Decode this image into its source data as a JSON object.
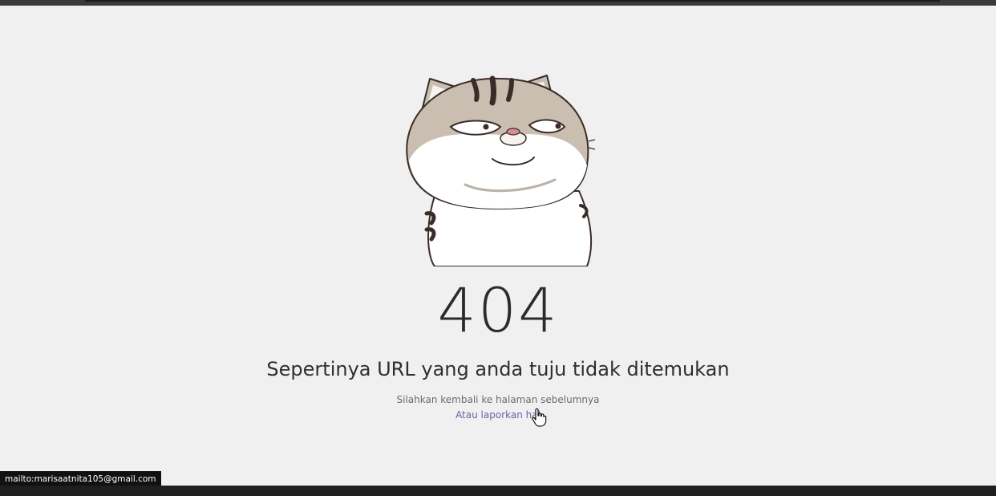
{
  "page": {
    "code": "404",
    "headline": "Sepertinya URL yang anda tuju tidak ditemukan",
    "subtext": "Silahkan kembali ke halaman sebelumnya",
    "report_link": "Atau laporkan hal"
  },
  "status_bar": {
    "text": "mailto:marisaatnita105@gmail.com"
  },
  "illustration": {
    "icon": "cat-sticker-illustration"
  },
  "colors": {
    "background": "#f0f0f0",
    "text": "#2b2b2b",
    "link": "#6f5fa8",
    "cat_fur": "#c9beb0",
    "cat_stripe": "#3a2c28"
  }
}
